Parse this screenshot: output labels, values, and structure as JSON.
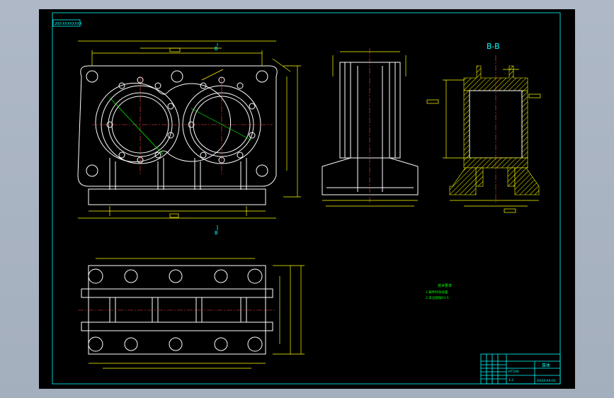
{
  "drawing": {
    "corner_tag": "200-XXXXXXXX",
    "section_label": "B-B",
    "section_mark_top": "B",
    "section_mark_bottom": "B",
    "notes_title": "技术要求",
    "notes": [
      "1.铸件时效处理",
      "2.未注圆角R3-5"
    ],
    "title_block": {
      "part_name": "泵体",
      "drawing_no": "XXXX-XX-01",
      "material": "HT200",
      "scale": "1:2"
    }
  },
  "colors": {
    "outline": "#ffffff",
    "dimension": "#ffff00",
    "hidden": "#00ff00",
    "frame": "#00ffff",
    "centerline": "#ff4040"
  }
}
